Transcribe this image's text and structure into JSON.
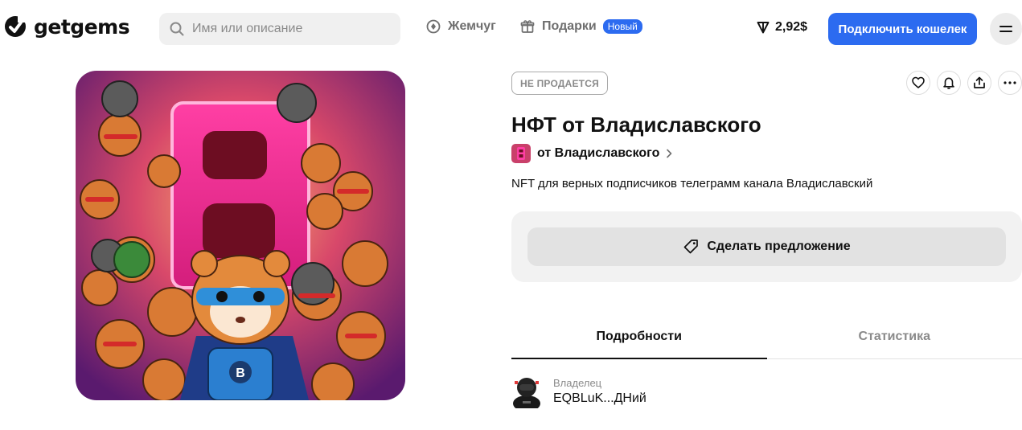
{
  "header": {
    "logo_text": "getgems",
    "search": {
      "placeholder": "Имя или описание",
      "value": ""
    },
    "nav": [
      {
        "label": "Жемчуг",
        "icon": "pearl-icon"
      },
      {
        "label": "Подарки",
        "icon": "gift-icon",
        "badge": "Новый"
      }
    ],
    "balance": "2,92$",
    "connect_label": "Подключить кошелек",
    "menu_icon": "menu-icon"
  },
  "colors": {
    "accent": "#2c6bf0",
    "muted": "#8a8a8a",
    "card_bg": "#f2f2f2"
  },
  "nft": {
    "image_icon": "nft-artwork",
    "image_letter": "B",
    "badge_letter": "B",
    "status": "НЕ ПРОДАЕТСЯ",
    "title": "НФТ от Владиславского",
    "collection": "от Владиславского",
    "description": "NFT для верных подписчиков телеграмм канала Владиславский",
    "offer_label": "Сделать предложение"
  },
  "actions": [
    {
      "name": "favorite",
      "icon": "heart-icon"
    },
    {
      "name": "notify",
      "icon": "bell-icon"
    },
    {
      "name": "share",
      "icon": "share-icon"
    },
    {
      "name": "more",
      "icon": "more-icon"
    }
  ],
  "tabs": [
    {
      "label": "Подробности",
      "active": true
    },
    {
      "label": "Статистика",
      "active": false
    }
  ],
  "owner": {
    "label": "Владелец",
    "value": "EQBLuK...ДНий"
  }
}
